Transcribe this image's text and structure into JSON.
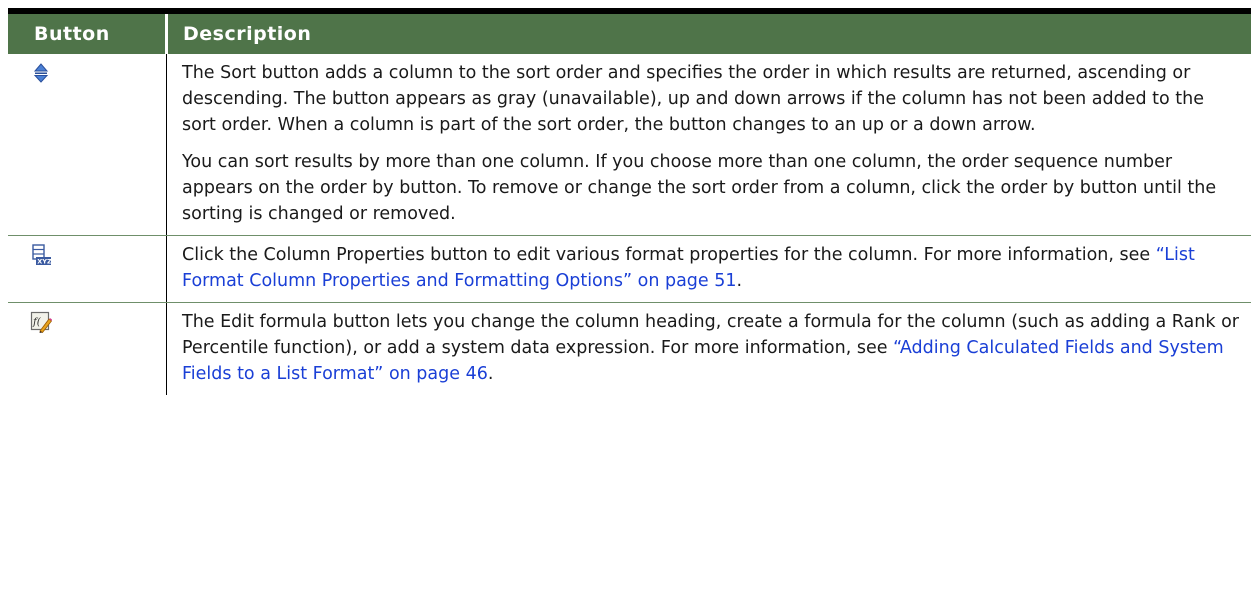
{
  "table": {
    "headers": {
      "button": "Button",
      "description": "Description"
    },
    "rows": [
      {
        "icon": "sort-arrows-icon",
        "paragraphs": [
          "The Sort button adds a column to the sort order and specifies the order in which results are returned, ascending or descending. The button appears as gray (unavailable), up and down arrows if the column has not been added to the sort order. When a column is part of the sort order, the button changes to an up or a down arrow.",
          "You can sort results by more than one column. If you choose more than one column, the order sequence number appears on the order by button. To remove or change the sort order from a column, click the order by button until the sorting is changed or removed."
        ]
      },
      {
        "icon": "column-properties-icon",
        "text_before": "Click the Column Properties button to edit various format properties for the column. For more information, see ",
        "link": "“List Format Column Properties and Formatting Options” on page 51",
        "text_after": "."
      },
      {
        "icon": "edit-formula-icon",
        "text_before": "The Edit formula button lets you change the column heading, create a formula for the column (such as adding a Rank or Percentile function), or add a system data expression. For more information, see ",
        "link": "“Adding Calculated Fields and System Fields to a List Format” on page 46",
        "text_after": "."
      }
    ]
  },
  "colors": {
    "header_bg": "#4f7449",
    "link": "#1a3fd6",
    "row_rule": "#6f8f6a"
  }
}
